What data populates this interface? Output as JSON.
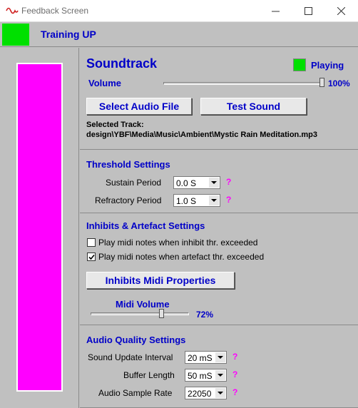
{
  "window": {
    "title": "Feedback Screen"
  },
  "header": {
    "title": "Training UP",
    "indicator_color": "#00e000"
  },
  "meter": {
    "fill_fraction": 1.0,
    "color": "#ff00ff"
  },
  "soundtrack": {
    "title": "Soundtrack",
    "status_label": "Playing",
    "volume_label": "Volume",
    "volume_value": "100%",
    "select_button": "Select Audio File",
    "test_button": "Test Sound",
    "selected_label": "Selected Track:",
    "selected_path": "design\\YBF\\Media\\Music\\Ambient\\Mystic Rain Meditation.mp3"
  },
  "threshold": {
    "title": "Threshold Settings",
    "sustain_label": "Sustain Period",
    "sustain_value": "0.0 S",
    "refractory_label": "Refractory Period",
    "refractory_value": "1.0 S",
    "help": "?"
  },
  "inhibits": {
    "title": "Inhibits & Artefact Settings",
    "opt1_label": "Play midi notes when inhibit thr. exceeded",
    "opt1_checked": false,
    "opt2_label": "Play midi notes when artefact thr. exceeded",
    "opt2_checked": true,
    "midi_button": "Inhibits Midi Properties",
    "midi_volume_label": "Midi Volume",
    "midi_volume_value": "72%"
  },
  "audio_quality": {
    "title": "Audio Quality Settings",
    "update_label": "Sound Update Interval",
    "update_value": "20 mS",
    "buffer_label": "Buffer Length",
    "buffer_value": "50 mS",
    "rate_label": "Audio Sample Rate",
    "rate_value": "22050",
    "help": "?"
  }
}
